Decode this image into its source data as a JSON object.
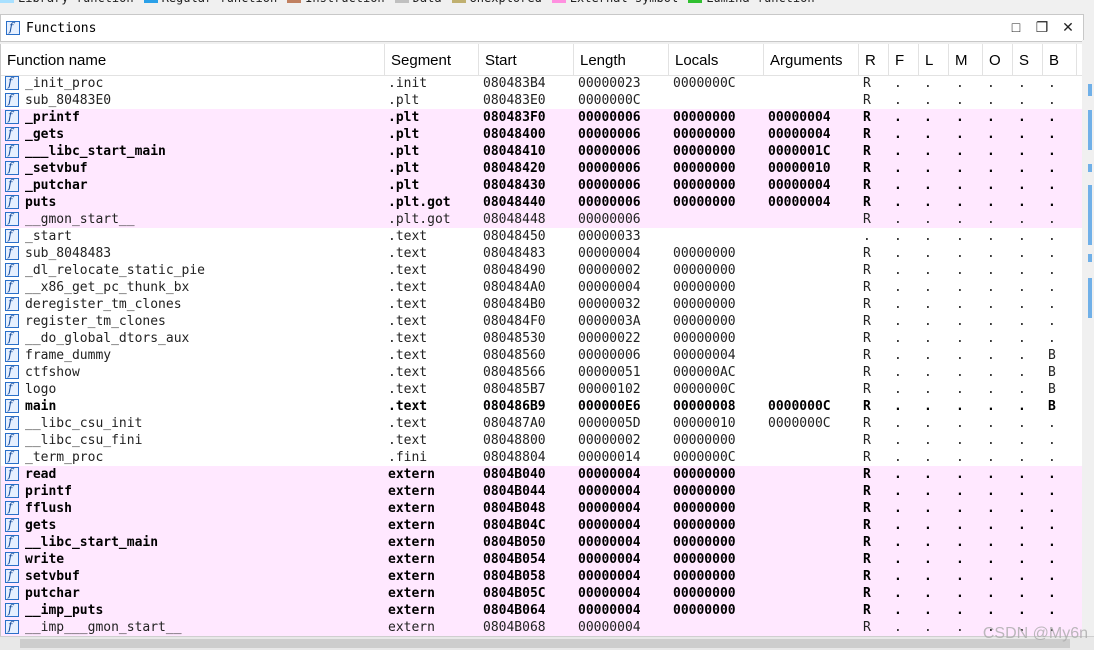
{
  "legend": [
    {
      "label": "Library function",
      "color": "#a8e0ff"
    },
    {
      "label": "Regular function",
      "color": "#2aa0e8"
    },
    {
      "label": "Instruction",
      "color": "#c08060"
    },
    {
      "label": "Data",
      "color": "#c0c0c0"
    },
    {
      "label": "Unexplored",
      "color": "#c0b070"
    },
    {
      "label": "External symbol",
      "color": "#ff90e0"
    },
    {
      "label": "Lumina function",
      "color": "#30c030"
    }
  ],
  "window": {
    "title": "Functions",
    "icon": "function-icon",
    "buttons": {
      "maximize": "□",
      "restore": "❐",
      "close": "✕"
    }
  },
  "columns": [
    "Function name",
    "Segment",
    "Start",
    "Length",
    "Locals",
    "Arguments",
    "R",
    "F",
    "L",
    "M",
    "O",
    "S",
    "B"
  ],
  "rows": [
    {
      "name": "_init_proc",
      "segment": ".init",
      "start": "080483B4",
      "length": "00000023",
      "locals": "0000000C",
      "args": "",
      "flags": [
        "R",
        ".",
        ".",
        ".",
        ".",
        ".",
        "."
      ],
      "style": "normal"
    },
    {
      "name": "sub_80483E0",
      "segment": ".plt",
      "start": "080483E0",
      "length": "0000000C",
      "locals": "",
      "args": "",
      "flags": [
        "R",
        ".",
        ".",
        ".",
        ".",
        ".",
        "."
      ],
      "style": "normal"
    },
    {
      "name": "_printf",
      "segment": ".plt",
      "start": "080483F0",
      "length": "00000006",
      "locals": "00000000",
      "args": "00000004",
      "flags": [
        "R",
        ".",
        ".",
        ".",
        ".",
        ".",
        "."
      ],
      "style": "pink-bold"
    },
    {
      "name": "_gets",
      "segment": ".plt",
      "start": "08048400",
      "length": "00000006",
      "locals": "00000000",
      "args": "00000004",
      "flags": [
        "R",
        ".",
        ".",
        ".",
        ".",
        ".",
        "."
      ],
      "style": "pink-bold"
    },
    {
      "name": "___libc_start_main",
      "segment": ".plt",
      "start": "08048410",
      "length": "00000006",
      "locals": "00000000",
      "args": "0000001C",
      "flags": [
        "R",
        ".",
        ".",
        ".",
        ".",
        ".",
        "."
      ],
      "style": "pink-bold"
    },
    {
      "name": "_setvbuf",
      "segment": ".plt",
      "start": "08048420",
      "length": "00000006",
      "locals": "00000000",
      "args": "00000010",
      "flags": [
        "R",
        ".",
        ".",
        ".",
        ".",
        ".",
        "."
      ],
      "style": "pink-bold"
    },
    {
      "name": "_putchar",
      "segment": ".plt",
      "start": "08048430",
      "length": "00000006",
      "locals": "00000000",
      "args": "00000004",
      "flags": [
        "R",
        ".",
        ".",
        ".",
        ".",
        ".",
        "."
      ],
      "style": "pink-bold"
    },
    {
      "name": "puts",
      "segment": ".plt.got",
      "start": "08048440",
      "length": "00000006",
      "locals": "00000000",
      "args": "00000004",
      "flags": [
        "R",
        ".",
        ".",
        ".",
        ".",
        ".",
        "."
      ],
      "style": "pink-bold"
    },
    {
      "name": "__gmon_start__",
      "segment": ".plt.got",
      "start": "08048448",
      "length": "00000006",
      "locals": "",
      "args": "",
      "flags": [
        "R",
        ".",
        ".",
        ".",
        ".",
        ".",
        "."
      ],
      "style": "pink"
    },
    {
      "name": "_start",
      "segment": ".text",
      "start": "08048450",
      "length": "00000033",
      "locals": "",
      "args": "",
      "flags": [
        ".",
        ".",
        ".",
        ".",
        ".",
        ".",
        "."
      ],
      "style": "normal"
    },
    {
      "name": "sub_8048483",
      "segment": ".text",
      "start": "08048483",
      "length": "00000004",
      "locals": "00000000",
      "args": "",
      "flags": [
        "R",
        ".",
        ".",
        ".",
        ".",
        ".",
        "."
      ],
      "style": "normal"
    },
    {
      "name": "_dl_relocate_static_pie",
      "segment": ".text",
      "start": "08048490",
      "length": "00000002",
      "locals": "00000000",
      "args": "",
      "flags": [
        "R",
        ".",
        ".",
        ".",
        ".",
        ".",
        "."
      ],
      "style": "normal"
    },
    {
      "name": "__x86_get_pc_thunk_bx",
      "segment": ".text",
      "start": "080484A0",
      "length": "00000004",
      "locals": "00000000",
      "args": "",
      "flags": [
        "R",
        ".",
        ".",
        ".",
        ".",
        ".",
        "."
      ],
      "style": "normal"
    },
    {
      "name": "deregister_tm_clones",
      "segment": ".text",
      "start": "080484B0",
      "length": "00000032",
      "locals": "00000000",
      "args": "",
      "flags": [
        "R",
        ".",
        ".",
        ".",
        ".",
        ".",
        "."
      ],
      "style": "normal"
    },
    {
      "name": "register_tm_clones",
      "segment": ".text",
      "start": "080484F0",
      "length": "0000003A",
      "locals": "00000000",
      "args": "",
      "flags": [
        "R",
        ".",
        ".",
        ".",
        ".",
        ".",
        "."
      ],
      "style": "normal"
    },
    {
      "name": "__do_global_dtors_aux",
      "segment": ".text",
      "start": "08048530",
      "length": "00000022",
      "locals": "00000000",
      "args": "",
      "flags": [
        "R",
        ".",
        ".",
        ".",
        ".",
        ".",
        "."
      ],
      "style": "normal"
    },
    {
      "name": "frame_dummy",
      "segment": ".text",
      "start": "08048560",
      "length": "00000006",
      "locals": "00000004",
      "args": "",
      "flags": [
        "R",
        ".",
        ".",
        ".",
        ".",
        ".",
        "B"
      ],
      "style": "normal"
    },
    {
      "name": "ctfshow",
      "segment": ".text",
      "start": "08048566",
      "length": "00000051",
      "locals": "000000AC",
      "args": "",
      "flags": [
        "R",
        ".",
        ".",
        ".",
        ".",
        ".",
        "B"
      ],
      "style": "normal"
    },
    {
      "name": "logo",
      "segment": ".text",
      "start": "080485B7",
      "length": "00000102",
      "locals": "0000000C",
      "args": "",
      "flags": [
        "R",
        ".",
        ".",
        ".",
        ".",
        ".",
        "B"
      ],
      "style": "normal"
    },
    {
      "name": "main",
      "segment": ".text",
      "start": "080486B9",
      "length": "000000E6",
      "locals": "00000008",
      "args": "0000000C",
      "flags": [
        "R",
        ".",
        ".",
        ".",
        ".",
        ".",
        "B"
      ],
      "style": "bold"
    },
    {
      "name": "__libc_csu_init",
      "segment": ".text",
      "start": "080487A0",
      "length": "0000005D",
      "locals": "00000010",
      "args": "0000000C",
      "flags": [
        "R",
        ".",
        ".",
        ".",
        ".",
        ".",
        "."
      ],
      "style": "normal"
    },
    {
      "name": "__libc_csu_fini",
      "segment": ".text",
      "start": "08048800",
      "length": "00000002",
      "locals": "00000000",
      "args": "",
      "flags": [
        "R",
        ".",
        ".",
        ".",
        ".",
        ".",
        "."
      ],
      "style": "normal"
    },
    {
      "name": "_term_proc",
      "segment": ".fini",
      "start": "08048804",
      "length": "00000014",
      "locals": "0000000C",
      "args": "",
      "flags": [
        "R",
        ".",
        ".",
        ".",
        ".",
        ".",
        "."
      ],
      "style": "normal"
    },
    {
      "name": "read",
      "segment": "extern",
      "start": "0804B040",
      "length": "00000004",
      "locals": "00000000",
      "args": "",
      "flags": [
        "R",
        ".",
        ".",
        ".",
        ".",
        ".",
        "."
      ],
      "style": "pink-bold"
    },
    {
      "name": "printf",
      "segment": "extern",
      "start": "0804B044",
      "length": "00000004",
      "locals": "00000000",
      "args": "",
      "flags": [
        "R",
        ".",
        ".",
        ".",
        ".",
        ".",
        "."
      ],
      "style": "pink-bold"
    },
    {
      "name": "fflush",
      "segment": "extern",
      "start": "0804B048",
      "length": "00000004",
      "locals": "00000000",
      "args": "",
      "flags": [
        "R",
        ".",
        ".",
        ".",
        ".",
        ".",
        "."
      ],
      "style": "pink-bold"
    },
    {
      "name": "gets",
      "segment": "extern",
      "start": "0804B04C",
      "length": "00000004",
      "locals": "00000000",
      "args": "",
      "flags": [
        "R",
        ".",
        ".",
        ".",
        ".",
        ".",
        "."
      ],
      "style": "pink-bold"
    },
    {
      "name": "__libc_start_main",
      "segment": "extern",
      "start": "0804B050",
      "length": "00000004",
      "locals": "00000000",
      "args": "",
      "flags": [
        "R",
        ".",
        ".",
        ".",
        ".",
        ".",
        "."
      ],
      "style": "pink-bold"
    },
    {
      "name": "write",
      "segment": "extern",
      "start": "0804B054",
      "length": "00000004",
      "locals": "00000000",
      "args": "",
      "flags": [
        "R",
        ".",
        ".",
        ".",
        ".",
        ".",
        "."
      ],
      "style": "pink-bold"
    },
    {
      "name": "setvbuf",
      "segment": "extern",
      "start": "0804B058",
      "length": "00000004",
      "locals": "00000000",
      "args": "",
      "flags": [
        "R",
        ".",
        ".",
        ".",
        ".",
        ".",
        "."
      ],
      "style": "pink-bold"
    },
    {
      "name": "putchar",
      "segment": "extern",
      "start": "0804B05C",
      "length": "00000004",
      "locals": "00000000",
      "args": "",
      "flags": [
        "R",
        ".",
        ".",
        ".",
        ".",
        ".",
        "."
      ],
      "style": "pink-bold"
    },
    {
      "name": "__imp_puts",
      "segment": "extern",
      "start": "0804B064",
      "length": "00000004",
      "locals": "00000000",
      "args": "",
      "flags": [
        "R",
        ".",
        ".",
        ".",
        ".",
        ".",
        "."
      ],
      "style": "pink-bold"
    },
    {
      "name": "__imp___gmon_start__",
      "segment": "extern",
      "start": "0804B068",
      "length": "00000004",
      "locals": "",
      "args": "",
      "flags": [
        "R",
        ".",
        ".",
        ".",
        ".",
        ".",
        "."
      ],
      "style": "pink"
    }
  ],
  "watermark": "CSDN @My6n"
}
